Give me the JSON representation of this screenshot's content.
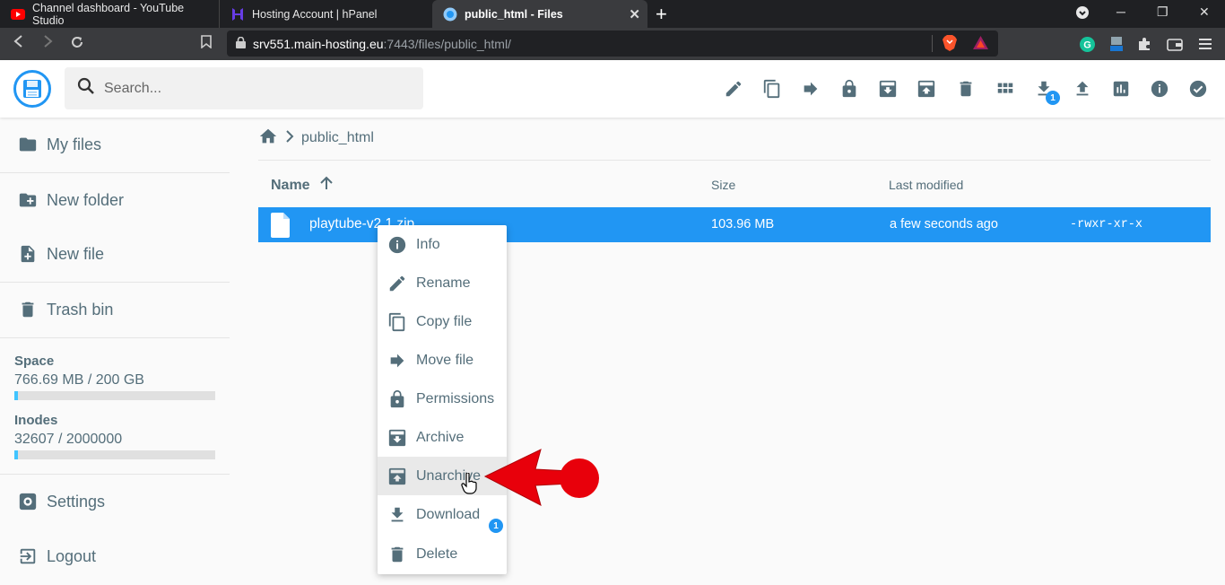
{
  "browser": {
    "tabs": [
      {
        "title": "Channel dashboard - YouTube Studio",
        "icon": "youtube-icon",
        "active": false
      },
      {
        "title": "Hosting Account | hPanel",
        "icon": "hostinger-icon",
        "active": false
      },
      {
        "title": "public_html - Files",
        "icon": "filebrowser-icon",
        "active": true
      }
    ],
    "url_host": "srv551.main-hosting.eu",
    "url_path": ":7443/files/public_html/"
  },
  "header": {
    "search_placeholder": "Search...",
    "download_badge": "1"
  },
  "sidebar": {
    "items": [
      {
        "label": "My files",
        "icon": "folder-icon"
      },
      {
        "label": "New folder",
        "icon": "new-folder-icon"
      },
      {
        "label": "New file",
        "icon": "new-file-icon"
      },
      {
        "label": "Trash bin",
        "icon": "trash-icon"
      }
    ],
    "space_label": "Space",
    "space_value": "766.69 MB / 200 GB",
    "space_fraction": 0.004,
    "inodes_label": "Inodes",
    "inodes_value": "32607 / 2000000",
    "inodes_fraction": 0.016,
    "settings_label": "Settings",
    "logout_label": "Logout"
  },
  "main": {
    "breadcrumb": "public_html",
    "columns": {
      "name": "Name",
      "size": "Size",
      "modified": "Last modified"
    },
    "files": [
      {
        "name": "playtube-v2.1.zip",
        "size": "103.96 MB",
        "modified": "a few seconds ago",
        "permissions": "-rwxr-xr-x"
      }
    ]
  },
  "context_menu": {
    "items": [
      {
        "label": "Info",
        "icon": "info-icon"
      },
      {
        "label": "Rename",
        "icon": "pencil-icon"
      },
      {
        "label": "Copy file",
        "icon": "copy-icon"
      },
      {
        "label": "Move file",
        "icon": "arrow-right-icon"
      },
      {
        "label": "Permissions",
        "icon": "lock-icon"
      },
      {
        "label": "Archive",
        "icon": "archive-icon"
      },
      {
        "label": "Unarchive",
        "icon": "unarchive-icon"
      },
      {
        "label": "Download",
        "icon": "download-icon"
      },
      {
        "label": "Delete",
        "icon": "delete-icon"
      }
    ],
    "download_badge": "1"
  },
  "colors": {
    "accent": "#2196f3",
    "arrow": "#e8000b",
    "text": "#546e7a"
  }
}
